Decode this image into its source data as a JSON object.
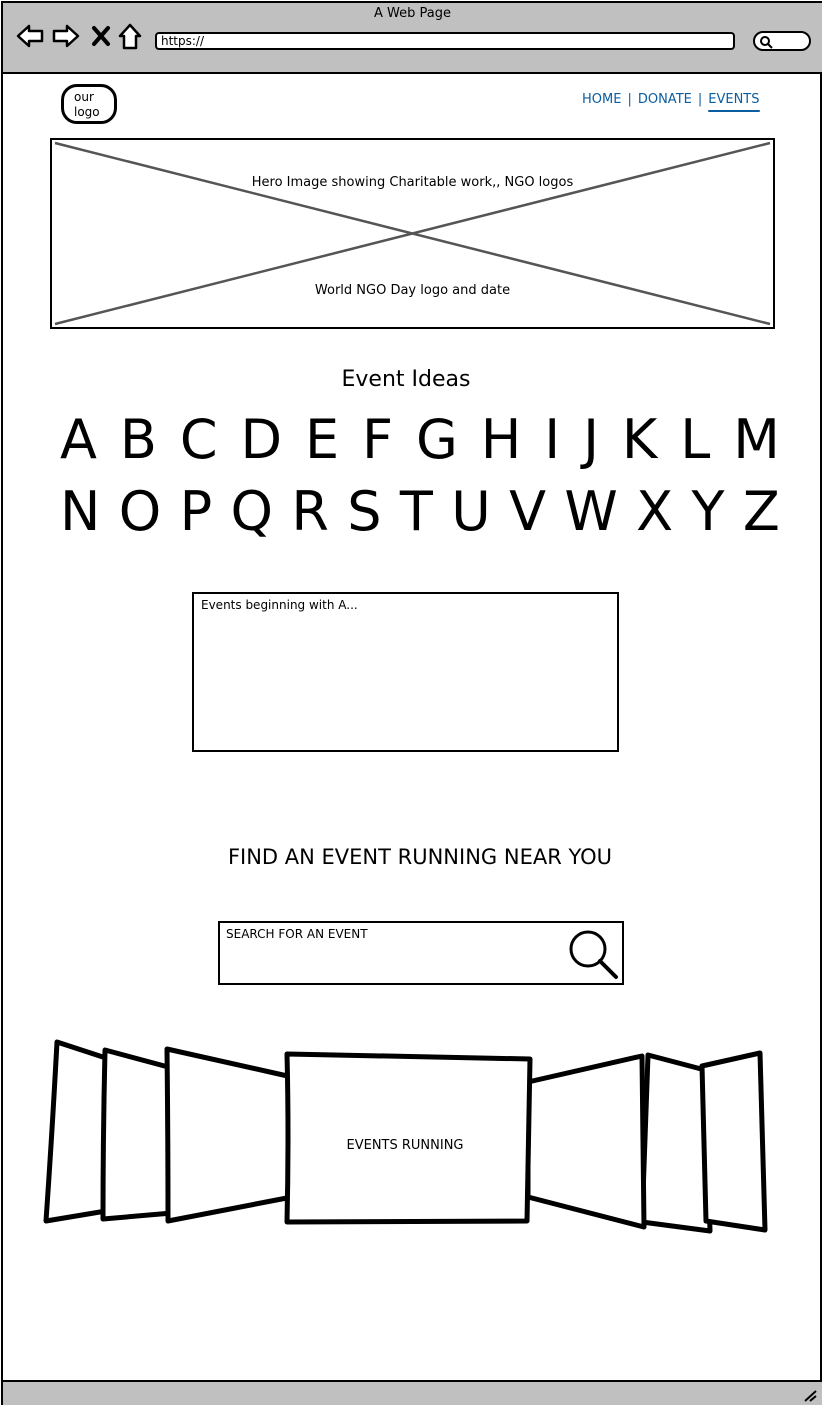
{
  "window": {
    "title": "A Web Page"
  },
  "browser": {
    "url": "https://",
    "icons": [
      "back-arrow-icon",
      "forward-arrow-icon",
      "close-icon",
      "home-icon",
      "search-icon"
    ]
  },
  "header": {
    "logo_line1": "our",
    "logo_line2": "logo",
    "nav": [
      {
        "label": "HOME"
      },
      {
        "label": "DONATE"
      },
      {
        "label": "EVENTS",
        "active": true
      }
    ],
    "nav_separator": "|",
    "nav_color": "#0b5da0"
  },
  "hero": {
    "line1": "Hero Image showing Charitable work,, NGO logos",
    "line2": "World NGO Day logo and date"
  },
  "ideas": {
    "heading": "Event Ideas",
    "row1": [
      "A",
      "B",
      "C",
      "D",
      "E",
      "F",
      "G",
      "H",
      "I",
      "J",
      "K",
      "L",
      "M"
    ],
    "row2": [
      "N",
      "O",
      "P",
      "Q",
      "R",
      "S",
      "T",
      "U",
      "V",
      "W",
      "X",
      "Y",
      "Z"
    ],
    "results_label": "Events beginning with A..."
  },
  "find": {
    "heading": "FIND AN EVENT RUNNING NEAR YOU",
    "search_placeholder": "SEARCH FOR AN EVENT"
  },
  "carousel": {
    "label": "EVENTS RUNNING"
  }
}
